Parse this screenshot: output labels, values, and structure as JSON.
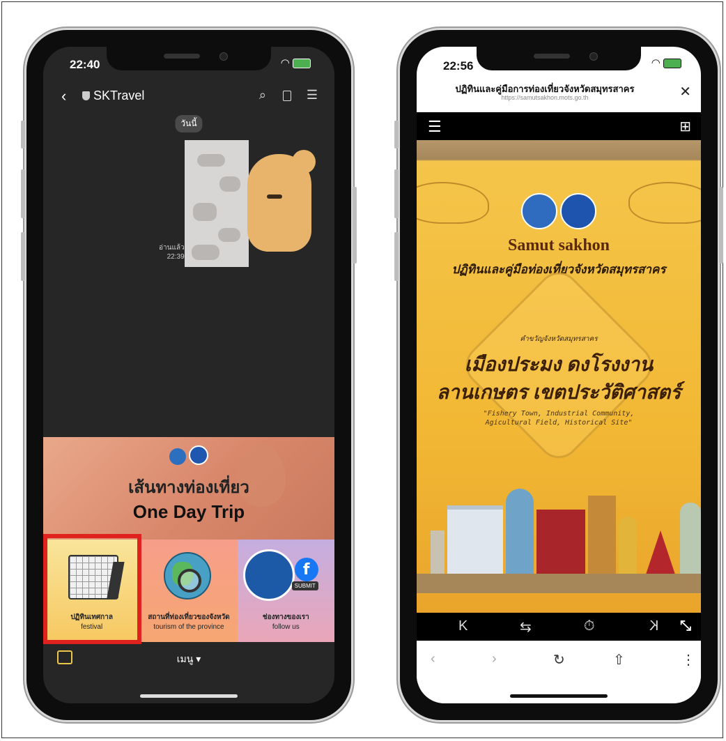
{
  "left_phone": {
    "status": {
      "time": "22:40"
    },
    "header": {
      "back": "‹",
      "title": "SKTravel"
    },
    "chat": {
      "date_label": "วันนี้",
      "read_label": "อ่านแล้ว",
      "read_time": "22:39"
    },
    "banner": {
      "line1": "เส้นทางท่องเที่ยว",
      "line2": "One Day Trip"
    },
    "menu": [
      {
        "th": "ปฏิทินเทศกาล",
        "en": "festival"
      },
      {
        "th": "สถานที่ท่องเที่ยวของจังหวัด",
        "en": "tourism of the province"
      },
      {
        "th": "ช่องทางของเรา",
        "en": "follow us"
      }
    ],
    "fb_letter": "f",
    "submit_label": "SUBMIT",
    "bottom_menu": "เมนู ▾",
    "highlight_color": "#e0221f"
  },
  "right_phone": {
    "status": {
      "time": "22:56"
    },
    "web": {
      "title": "ปฏิทินและคู่มือการท่องเที่ยวจังหวัดสมุทรสาคร",
      "url": "https://samutsakhon.mots.go.th",
      "close": "✕"
    },
    "poster": {
      "name_en": "Samut sakhon",
      "name_th": "ปฏิทินและคู่มือท่องเที่ยวจังหวัดสมุทรสาคร",
      "small": "คำขวัญจังหวัดสมุทรสาคร",
      "motto1": "เมืองประมง ดงโรงงาน",
      "motto2": "ลานเกษตร เขตประวัติศาสตร์",
      "quote1": "\"Fishery Town, Industrial Community,",
      "quote2": "Agicultural Field, Historical Site\""
    },
    "controls": [
      "K",
      "⇆",
      "⏱",
      "K",
      "⤡"
    ],
    "browser": [
      "‹",
      "›",
      "↻",
      "⇧",
      "⋮"
    ]
  }
}
